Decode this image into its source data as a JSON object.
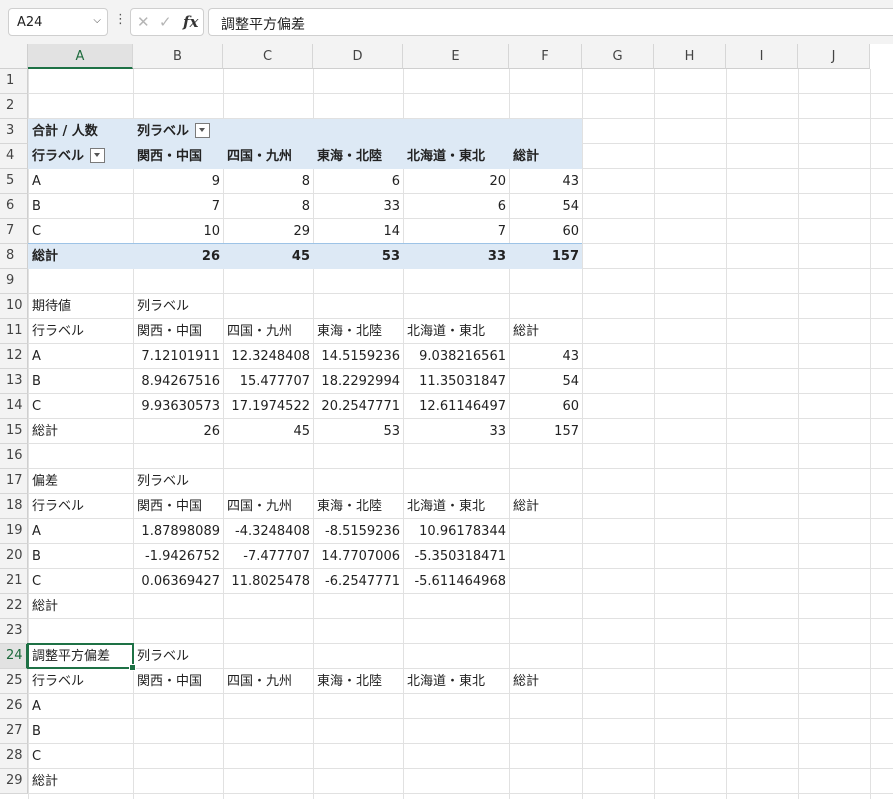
{
  "formula_bar": {
    "name_box": "A24",
    "cancel_symbol": "✕",
    "enter_symbol": "✓",
    "fx_label": "fx",
    "formula": "調整平方偏差"
  },
  "sheet": {
    "columns": [
      "A",
      "B",
      "C",
      "D",
      "E",
      "F",
      "G",
      "H",
      "I",
      "J"
    ],
    "rows": [
      "1",
      "2",
      "3",
      "4",
      "5",
      "6",
      "7",
      "8",
      "9",
      "10",
      "11",
      "12",
      "13",
      "14",
      "15",
      "16",
      "17",
      "18",
      "19",
      "20",
      "21",
      "22",
      "23",
      "24",
      "25",
      "26",
      "27",
      "28",
      "29"
    ],
    "selected_cell": "A24",
    "accent_color": "#1e7145",
    "pivot_band_color": "#dde9f5"
  },
  "pivot": {
    "corner": "合計 / 人数",
    "col_labels": "列ラベル",
    "row_labels": "行ラベル",
    "headers": [
      "関西・中国",
      "四国・九州",
      "東海・北陸",
      "北海道・東北",
      "総計"
    ],
    "rows": [
      {
        "label": "A",
        "values": [
          "9",
          "8",
          "6",
          "20",
          "43"
        ]
      },
      {
        "label": "B",
        "values": [
          "7",
          "8",
          "33",
          "6",
          "54"
        ]
      },
      {
        "label": "C",
        "values": [
          "10",
          "29",
          "14",
          "7",
          "60"
        ]
      }
    ],
    "total": {
      "label": "総計",
      "values": [
        "26",
        "45",
        "53",
        "33",
        "157"
      ]
    }
  },
  "expected": {
    "title": "期待値",
    "col_labels": "列ラベル",
    "row_labels": "行ラベル",
    "headers": [
      "関西・中国",
      "四国・九州",
      "東海・北陸",
      "北海道・東北",
      "総計"
    ],
    "rows": [
      {
        "label": "A",
        "values": [
          "7.12101911",
          "12.3248408",
          "14.5159236",
          "9.038216561",
          "43"
        ]
      },
      {
        "label": "B",
        "values": [
          "8.94267516",
          "15.477707",
          "18.2292994",
          "11.35031847",
          "54"
        ]
      },
      {
        "label": "C",
        "values": [
          "9.93630573",
          "17.1974522",
          "20.2547771",
          "12.61146497",
          "60"
        ]
      }
    ],
    "total": {
      "label": "総計",
      "values": [
        "26",
        "45",
        "53",
        "33",
        "157"
      ]
    }
  },
  "deviation": {
    "title": "偏差",
    "col_labels": "列ラベル",
    "row_labels": "行ラベル",
    "headers": [
      "関西・中国",
      "四国・九州",
      "東海・北陸",
      "北海道・東北",
      "総計"
    ],
    "rows": [
      {
        "label": "A",
        "values": [
          "1.87898089",
          "-4.3248408",
          "-8.5159236",
          "10.96178344"
        ]
      },
      {
        "label": "B",
        "values": [
          "-1.9426752",
          "-7.477707",
          "14.7707006",
          "-5.350318471"
        ]
      },
      {
        "label": "C",
        "values": [
          "0.06369427",
          "11.8025478",
          "-6.2547771",
          "-5.611464968"
        ]
      }
    ],
    "total_label": "総計"
  },
  "adjusted": {
    "title": "調整平方偏差",
    "col_labels": "列ラベル",
    "row_labels": "行ラベル",
    "headers": [
      "関西・中国",
      "四国・九州",
      "東海・北陸",
      "北海道・東北",
      "総計"
    ],
    "rows": [
      "A",
      "B",
      "C"
    ],
    "total_label": "総計"
  }
}
